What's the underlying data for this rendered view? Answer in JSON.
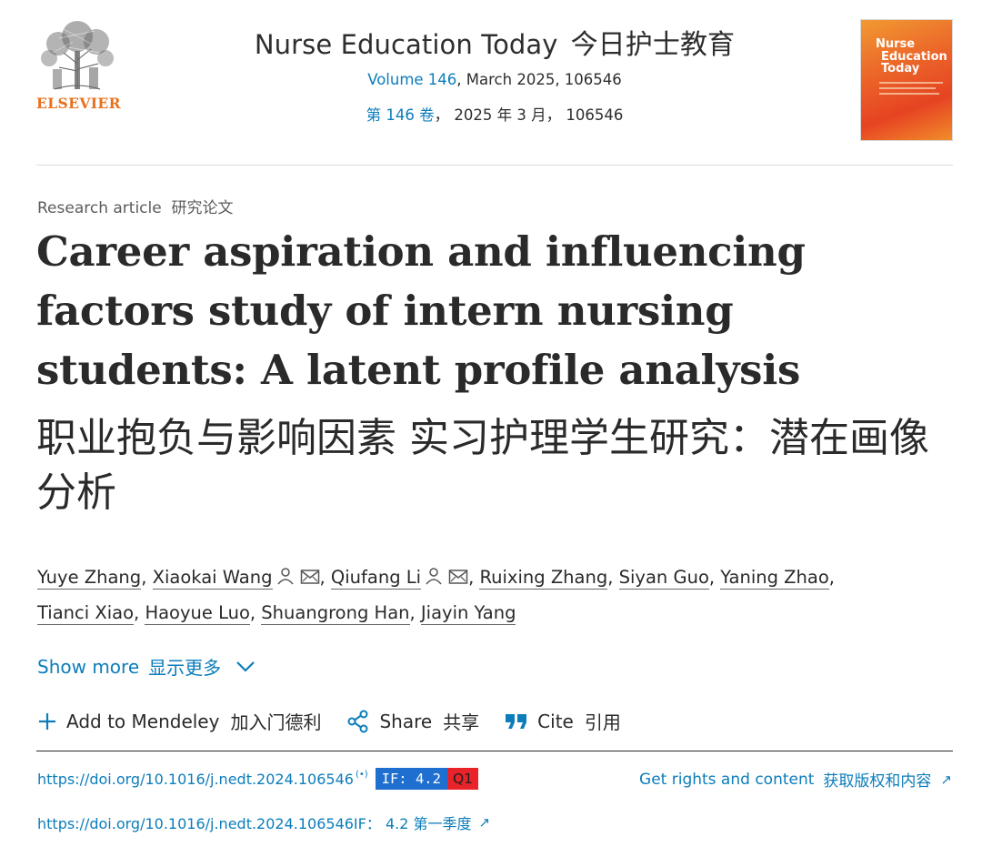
{
  "publisher": {
    "name": "ELSEVIER"
  },
  "journal": {
    "title": "Nurse Education Today",
    "title_cn": "今日护士教育",
    "volume_link": "Volume 146",
    "volume_rest": ", March 2025, 106546",
    "volume_cn_prefix": "第 146 卷",
    "volume_cn_rest": "， 2025 年 3 月， 106546",
    "cover_title_lines": [
      "Nurse",
      "Education",
      "Today"
    ]
  },
  "article": {
    "type": "Research article",
    "type_cn": "研究论文",
    "title_en": "Career aspiration and influencing factors study of intern nursing students: A latent profile analysis",
    "title_cn": "职业抱负与影响因素 实习护理学生研究：潜在画像分析"
  },
  "authors": [
    {
      "name": "Yuye Zhang",
      "icons": false
    },
    {
      "name": "Xiaokai Wang",
      "icons": true
    },
    {
      "name": "Qiufang Li",
      "icons": true
    },
    {
      "name": "Ruixing Zhang",
      "icons": false
    },
    {
      "name": "Siyan Guo",
      "icons": false
    },
    {
      "name": "Yaning Zhao",
      "icons": false
    },
    {
      "name": "Tianci Xiao",
      "icons": false
    },
    {
      "name": "Haoyue Luo",
      "icons": false
    },
    {
      "name": "Shuangrong Han",
      "icons": false
    },
    {
      "name": "Jiayin Yang",
      "icons": false
    }
  ],
  "show_more": {
    "label": "Show more",
    "label_cn": "显示更多"
  },
  "toolbar": {
    "mendeley": "Add to Mendeley",
    "mendeley_cn": "加入门德利",
    "share": "Share",
    "share_cn": "共享",
    "cite": "Cite",
    "cite_cn": "引用"
  },
  "doi": {
    "url": "https://doi.org/10.1016/j.nedt.2024.106546",
    "radio": "(•)",
    "if_badge": "IF: 4.2",
    "quartile": "Q1",
    "line2": "https://doi.org/10.1016/j.nedt.2024.106546IF： 4.2 第一季度"
  },
  "rights": {
    "label": "Get rights and content",
    "label_cn": "获取版权和内容"
  },
  "colors": {
    "link": "#0c7dbb",
    "publisher": "#e9711c",
    "if_badge": "#1e6fcf",
    "quartile_badge": "#e8232a"
  },
  "icons": [
    "elsevier-tree-logo",
    "person-icon",
    "envelope-icon",
    "chevron-down-icon",
    "plus-icon",
    "share-icon",
    "quote-icon",
    "external-arrow-icon"
  ]
}
